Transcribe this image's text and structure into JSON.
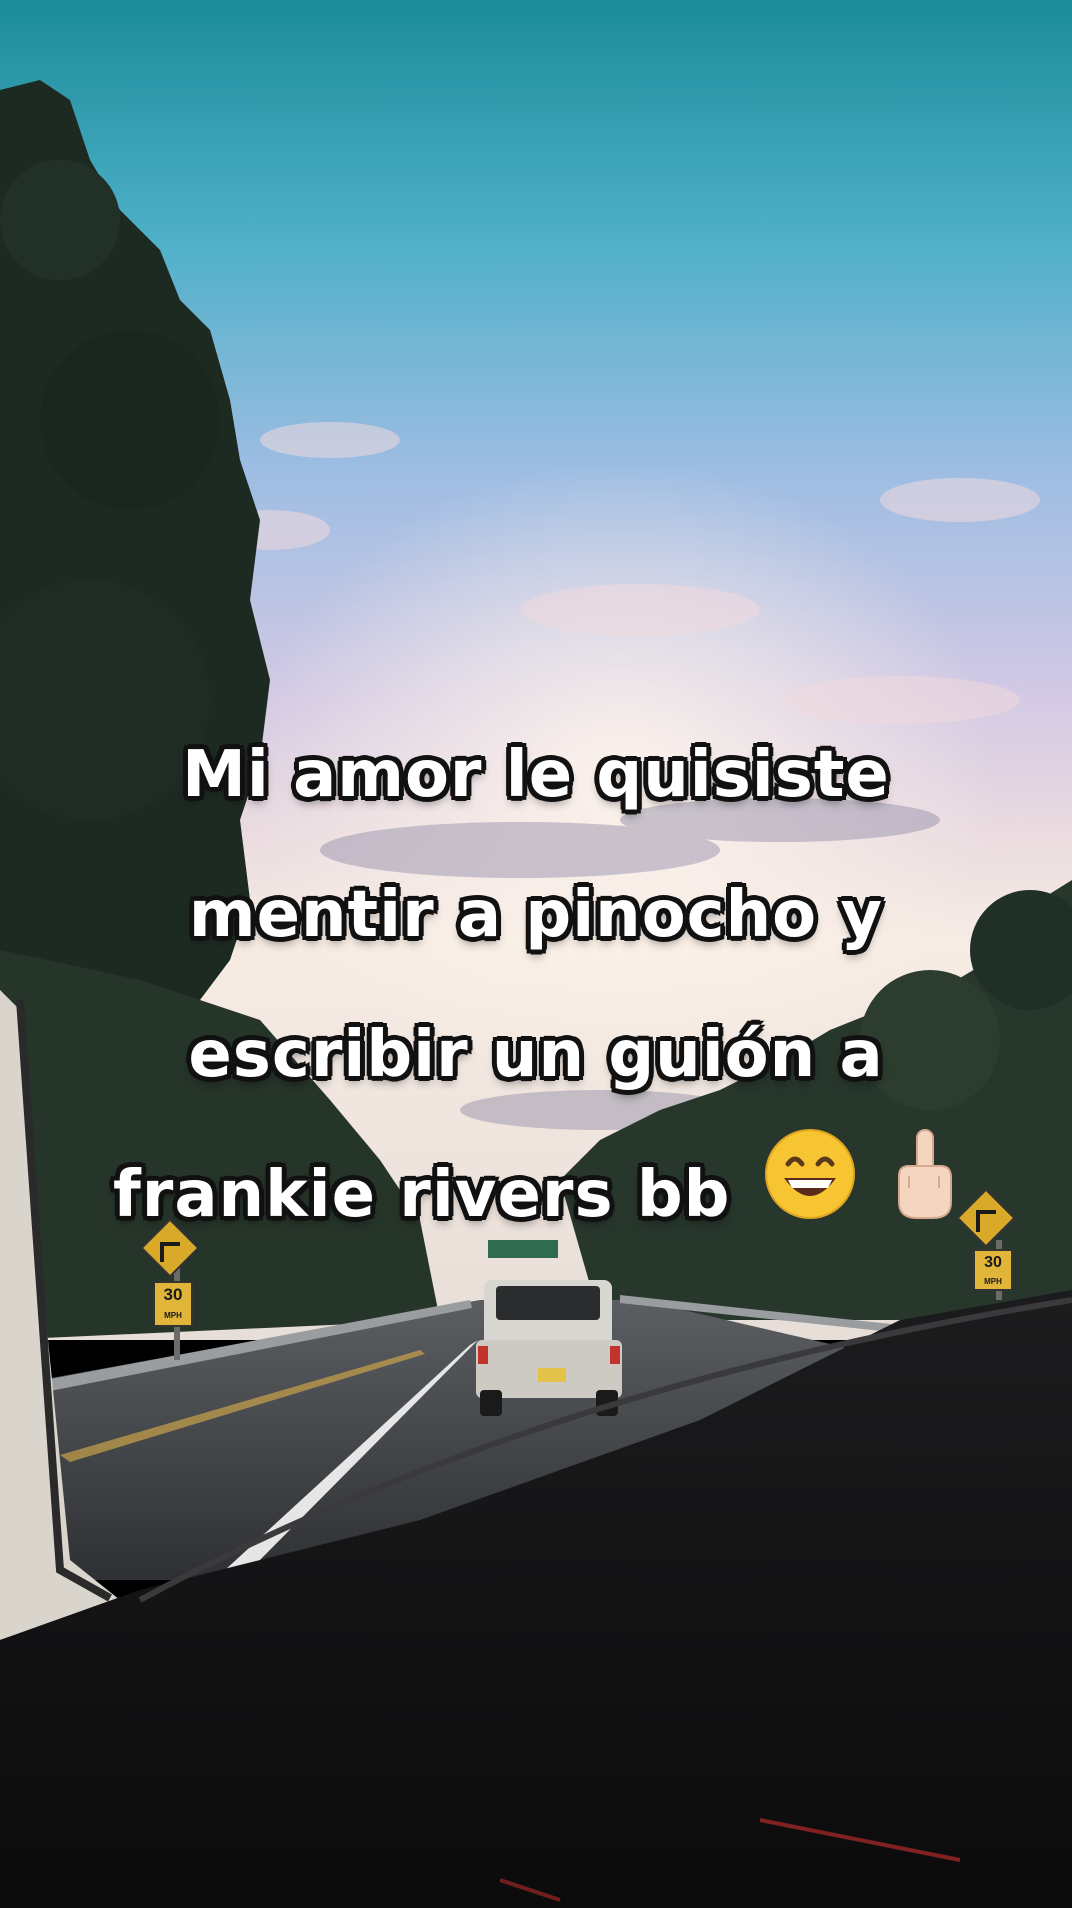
{
  "caption": {
    "line1": "Mi amor le quisiste",
    "line2": "mentir a pinocho y",
    "line3": "escribir un guión a",
    "line4": "frankie rivers bb"
  },
  "emojis": [
    "grinning-face-emoji",
    "middle-finger-emoji"
  ],
  "signs": {
    "left_speed": "30",
    "right_speed": "30",
    "speed_unit": "MPH"
  },
  "colors": {
    "sky_top": "#1f8f9c",
    "sky_mid": "#b9c7e6",
    "horizon": "#f3e6dc",
    "caption_text": "#ffffff",
    "caption_outline": "#111111",
    "sign_yellow": "#d9a92a"
  }
}
